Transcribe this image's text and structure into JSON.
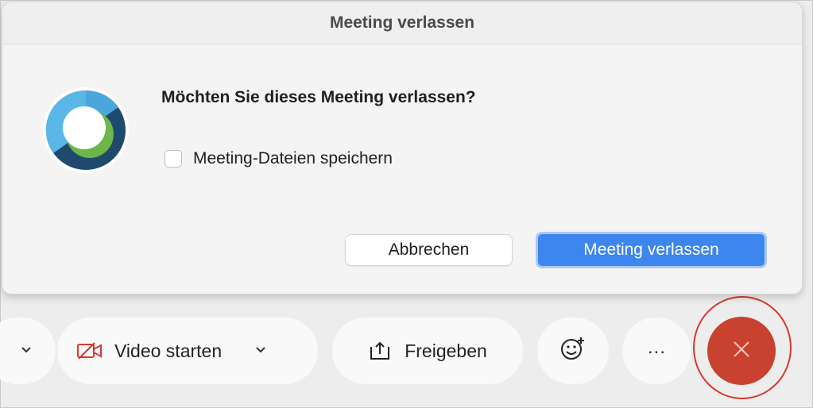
{
  "dialog": {
    "title": "Meeting verlassen",
    "question": "Möchten Sie dieses Meeting verlassen?",
    "checkbox_label": "Meeting-Dateien speichern",
    "checkbox_checked": false,
    "cancel_label": "Abbrechen",
    "confirm_label": "Meeting verlassen",
    "app_icon": "webex-logo-icon"
  },
  "toolbar": {
    "video_label": "Video starten",
    "video_icon": "video-off-icon",
    "share_label": "Freigeben",
    "share_icon": "share-upload-icon",
    "more_label": "···",
    "reactions_icon": "emoji-add-icon",
    "end_icon": "close-icon"
  },
  "colors": {
    "accent": "#3c86ee",
    "end_button": "#c9412f",
    "highlight": "#d43a2e"
  }
}
